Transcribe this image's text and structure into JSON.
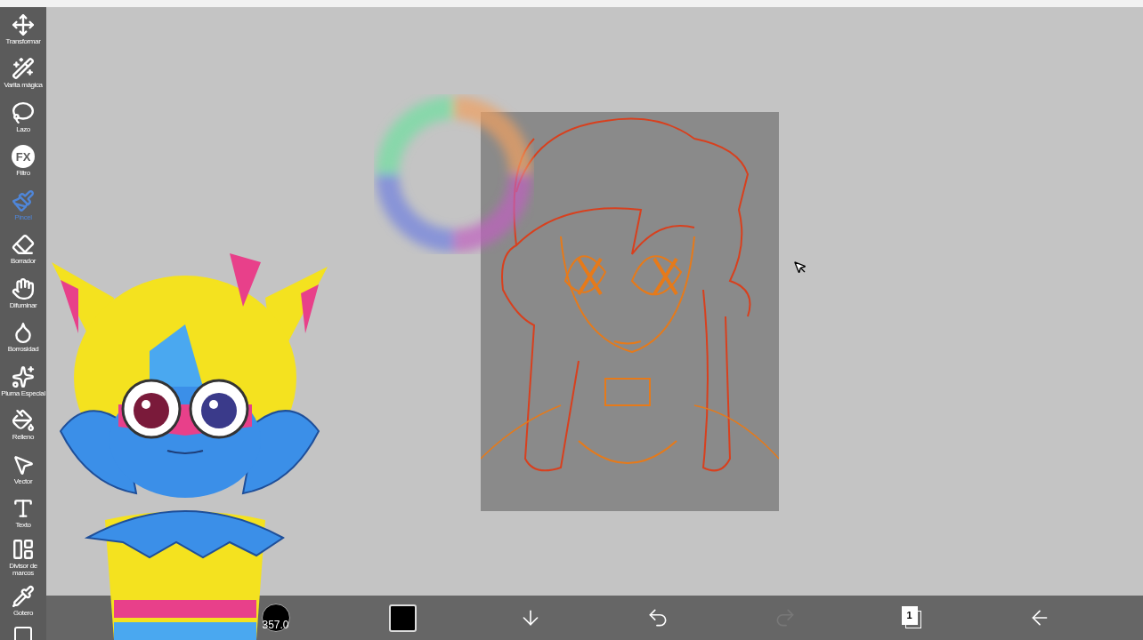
{
  "tools": [
    {
      "label": "Transformar",
      "selected": false
    },
    {
      "label": "Varita mágica",
      "selected": false
    },
    {
      "label": "Lazo",
      "selected": false
    },
    {
      "label": "Filtro",
      "selected": false,
      "icon_text": "FX"
    },
    {
      "label": "Pincel",
      "selected": true
    },
    {
      "label": "Borrador",
      "selected": false
    },
    {
      "label": "Difuminar",
      "selected": false
    },
    {
      "label": "Borrosidad",
      "selected": false
    },
    {
      "label": "Pluma Especial",
      "selected": false
    },
    {
      "label": "Relleno",
      "selected": false
    },
    {
      "label": "Vector",
      "selected": false
    },
    {
      "label": "Texto",
      "selected": false
    },
    {
      "label": "Divisor de marcos",
      "selected": false
    },
    {
      "label": "Gotero",
      "selected": false
    }
  ],
  "bottom_bar": {
    "brush_size": "357.0",
    "color": "#000000",
    "buttons": [
      {
        "kind": "download",
        "disabled": false
      },
      {
        "kind": "undo",
        "disabled": false
      },
      {
        "kind": "redo",
        "disabled": true
      },
      {
        "kind": "layers",
        "label": "1",
        "disabled": false
      },
      {
        "kind": "back",
        "disabled": false
      }
    ]
  }
}
